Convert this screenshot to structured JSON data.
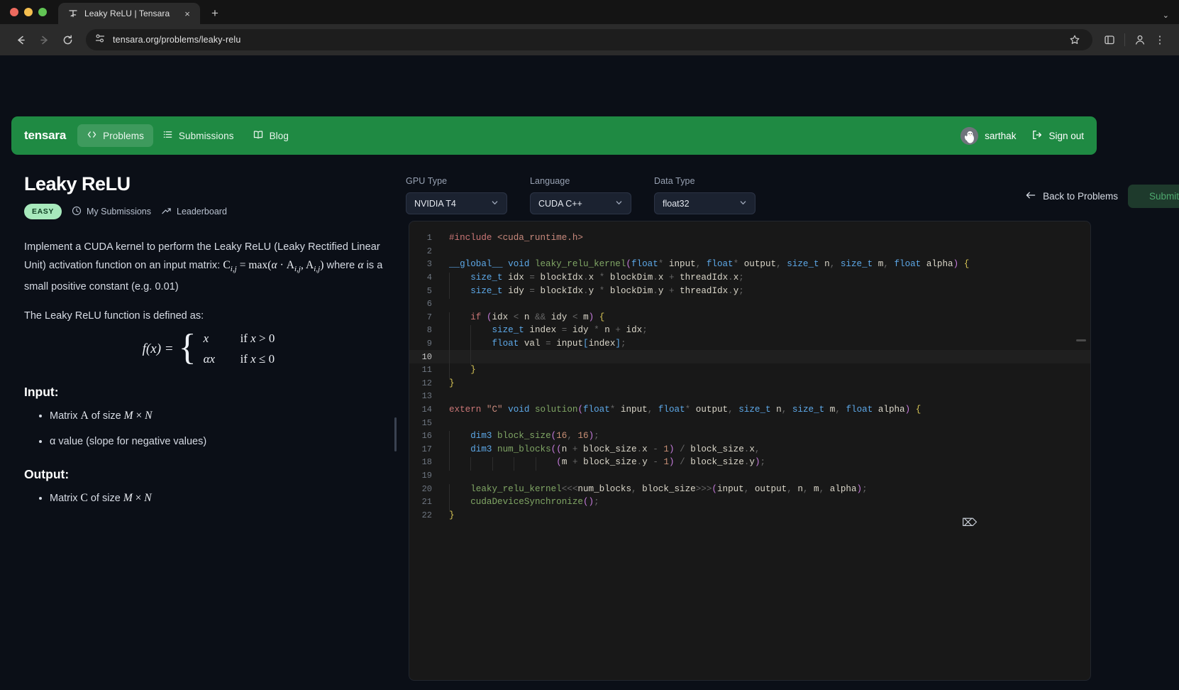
{
  "browser": {
    "tab_title": "Leaky ReLU | Tensara",
    "tab_favicon": "tensara-logo-icon",
    "close_label": "×",
    "newtab_label": "+",
    "chevron_label": "⌄",
    "url": "tensara.org/problems/leaky-relu",
    "back_icon": "←",
    "forward_icon": "→",
    "reload_icon": "⟳",
    "star_icon": "☆",
    "menu_icon": "⋮"
  },
  "appnav": {
    "brand": "tensara",
    "items": [
      {
        "label": "Problems",
        "icon": "code-brackets-icon",
        "active": true
      },
      {
        "label": "Submissions",
        "icon": "list-icon",
        "active": false
      },
      {
        "label": "Blog",
        "icon": "book-icon",
        "active": false
      }
    ],
    "username": "sarthak",
    "signout_label": "Sign out",
    "accent": "#1f8a43"
  },
  "problem": {
    "title": "Leaky ReLU",
    "difficulty": "EASY",
    "my_submissions": "My Submissions",
    "leaderboard": "Leaderboard",
    "desc_part1": "Implement a CUDA kernel to perform the Leaky ReLU (Leaky Rectified Linear Unit) activation function on an input matrix: ",
    "desc_formula": "C",
    "desc_formula_sub": "i,j",
    "desc_formula_mid": " = max(",
    "desc_alpha": "α",
    "desc_dot": " · A",
    "desc_sub2": "i,j",
    "desc_comma": ", A",
    "desc_sub3": "i,j",
    "desc_close": ")",
    "desc_part2": " where ",
    "desc_part3": " is a small positive constant (e.g. 0.01)",
    "defined_as": "The Leaky ReLU function is defined as:",
    "equation": {
      "lhs": "f(x) =",
      "case1_value": "x",
      "case1_cond": "if x > 0",
      "case2_value": "αx",
      "case2_cond": "if x ≤ 0"
    },
    "input_heading": "Input:",
    "input_items_pre": [
      "Matrix ",
      "α value (slope for negative values)"
    ],
    "input_item1_a": "A",
    "input_item1_mid": " of size ",
    "input_item1_m": "M",
    "input_item1_x": " × ",
    "input_item1_n": "N",
    "output_heading": "Output:",
    "output_item_pre": "Matrix ",
    "output_item_c": "C",
    "output_item_mid": " of size ",
    "output_item_m": "M",
    "output_item_x": " × ",
    "output_item_n": "N"
  },
  "controls": {
    "gpu_label": "GPU Type",
    "gpu_value": "NVIDIA T4",
    "lang_label": "Language",
    "lang_value": "CUDA C++",
    "dtype_label": "Data Type",
    "dtype_value": "float32",
    "chevron": "⌄",
    "back_label": "Back to Problems",
    "back_icon": "←",
    "submit_label": "Submit"
  },
  "editor": {
    "active_line": 10,
    "lines": [
      {
        "n": 1,
        "text": "#include <cuda_runtime.h>"
      },
      {
        "n": 2,
        "text": ""
      },
      {
        "n": 3,
        "text": "__global__ void leaky_relu_kernel(float* input, float* output, size_t n, size_t m, float alpha) {"
      },
      {
        "n": 4,
        "text": "    size_t idx = blockIdx.x * blockDim.x + threadIdx.x;"
      },
      {
        "n": 5,
        "text": "    size_t idy = blockIdx.y * blockDim.y + threadIdx.y;"
      },
      {
        "n": 6,
        "text": ""
      },
      {
        "n": 7,
        "text": "    if (idx < n && idy < m) {"
      },
      {
        "n": 8,
        "text": "        size_t index = idy * n + idx;"
      },
      {
        "n": 9,
        "text": "        float val = input[index];"
      },
      {
        "n": 10,
        "text": "        "
      },
      {
        "n": 11,
        "text": "    }"
      },
      {
        "n": 12,
        "text": "}"
      },
      {
        "n": 13,
        "text": ""
      },
      {
        "n": 14,
        "text": "extern \"C\" void solution(float* input, float* output, size_t n, size_t m, float alpha) {"
      },
      {
        "n": 15,
        "text": ""
      },
      {
        "n": 16,
        "text": "    dim3 block_size(16, 16);"
      },
      {
        "n": 17,
        "text": "    dim3 num_blocks((n + block_size.x - 1) / block_size.x,"
      },
      {
        "n": 18,
        "text": "                    (m + block_size.y - 1) / block_size.y);"
      },
      {
        "n": 19,
        "text": ""
      },
      {
        "n": 20,
        "text": "    leaky_relu_kernel<<<num_blocks, block_size>>>(input, output, n, m, alpha);"
      },
      {
        "n": 21,
        "text": "    cudaDeviceSynchronize();"
      },
      {
        "n": 22,
        "text": "}"
      }
    ]
  }
}
